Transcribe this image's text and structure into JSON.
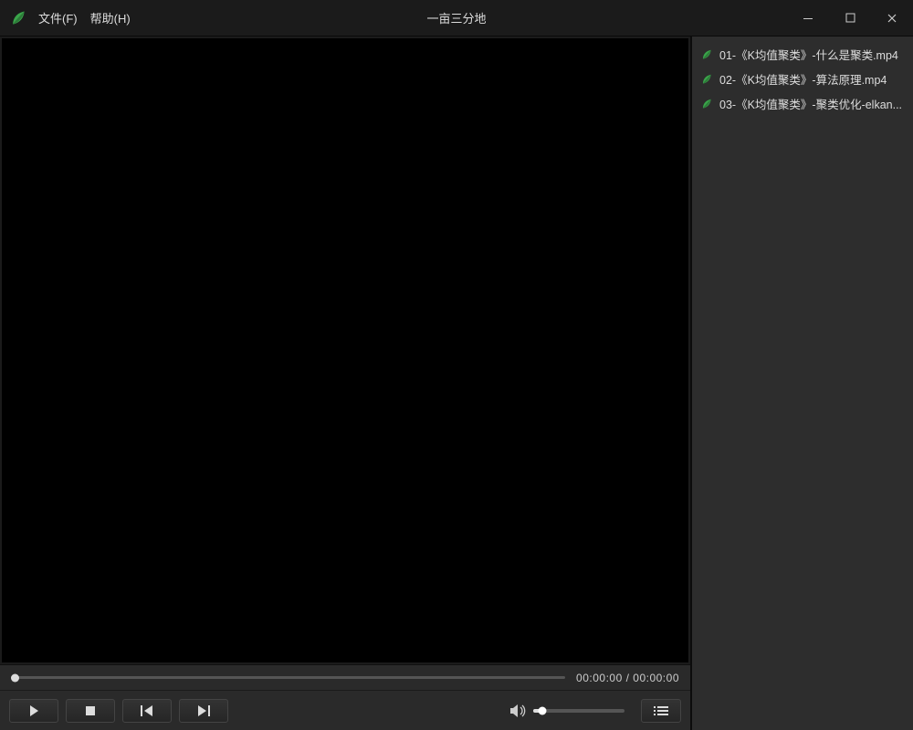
{
  "window": {
    "title": "一亩三分地"
  },
  "menu": {
    "file": "文件(F)",
    "help": "帮助(H)"
  },
  "playback": {
    "current_time": "00:00:00",
    "total_time": "00:00:00",
    "separator": " / "
  },
  "playlist": {
    "items": [
      {
        "label": "01-《K均值聚类》-什么是聚类.mp4"
      },
      {
        "label": "02-《K均值聚类》-算法原理.mp4"
      },
      {
        "label": "03-《K均值聚类》-聚类优化-elkan..."
      }
    ]
  },
  "colors": {
    "accent": "#2d8a3e"
  }
}
